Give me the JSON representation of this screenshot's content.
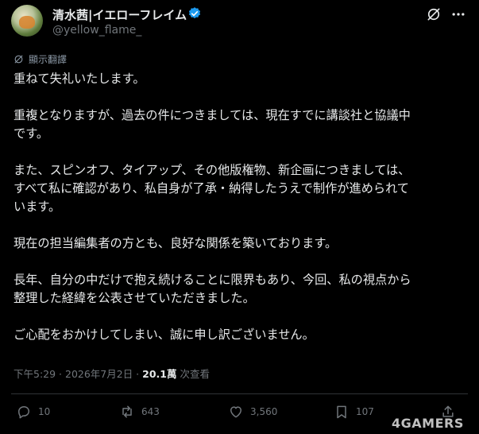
{
  "author": {
    "display_name": "清水茜|イエローフレイム",
    "handle": "@yellow_flame_",
    "verified": true
  },
  "translate_label": "顯示翻譯",
  "paragraphs": [
    "重ねて失礼いたします。",
    "重複となりますが、過去の件につきましては、現在すでに講談社と協議中\nです。",
    "また、スピンオフ、タイアップ、その他版権物、新企画につきましては、\nすべて私に確認があり、私自身が了承・納得したうえで制作が進められて\nいます。",
    "現在の担当編集者の方とも、良好な関係を築いております。",
    "長年、自分の中だけで抱え続けることに限界もあり、今回、私の視点から\n整理した経緯を公表させていただきました。",
    "ご心配をおかけしてしまい、誠に申し訳ございません。"
  ],
  "meta": {
    "timestamp": "下午5:29 · 2026年7月2日 · ",
    "views_count": "20.1萬",
    "views_label": " 次查看"
  },
  "actions": {
    "replies": "10",
    "reposts": "643",
    "likes": "3,560",
    "bookmarks": "107"
  },
  "watermark": "4GAMERS",
  "colors": {
    "background": "#000000",
    "text": "#e7e9ea",
    "secondary": "#71767b",
    "verified_badge": "#1d9bf0"
  },
  "icons": [
    "grok-icon",
    "more-icon",
    "translate-icon",
    "reply-icon",
    "repost-icon",
    "like-icon",
    "bookmark-icon",
    "share-icon",
    "verified-icon"
  ]
}
